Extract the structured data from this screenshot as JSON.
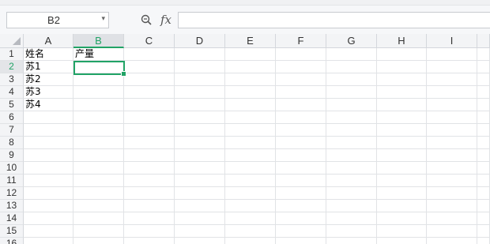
{
  "namebox": {
    "value": "B2"
  },
  "formula_bar": {
    "fx_label": "fx",
    "value": ""
  },
  "columns": [
    {
      "label": "A",
      "width": 63
    },
    {
      "label": "B",
      "width": 64,
      "active": true
    },
    {
      "label": "C",
      "width": 64
    },
    {
      "label": "D",
      "width": 64
    },
    {
      "label": "E",
      "width": 64
    },
    {
      "label": "F",
      "width": 64
    },
    {
      "label": "G",
      "width": 64
    },
    {
      "label": "H",
      "width": 63
    },
    {
      "label": "I",
      "width": 64
    }
  ],
  "rows": [
    {
      "label": "1",
      "cells": [
        "姓名",
        "产量"
      ]
    },
    {
      "label": "2",
      "cells": [
        "苏1",
        ""
      ],
      "active": true
    },
    {
      "label": "3",
      "cells": [
        "苏2",
        ""
      ]
    },
    {
      "label": "4",
      "cells": [
        "苏3",
        ""
      ]
    },
    {
      "label": "5",
      "cells": [
        "苏4",
        ""
      ]
    },
    {
      "label": "6",
      "cells": [
        "",
        ""
      ]
    },
    {
      "label": "7",
      "cells": [
        "",
        ""
      ]
    },
    {
      "label": "8",
      "cells": [
        "",
        ""
      ]
    },
    {
      "label": "9",
      "cells": [
        "",
        ""
      ]
    },
    {
      "label": "10",
      "cells": [
        "",
        ""
      ]
    },
    {
      "label": "11",
      "cells": [
        "",
        ""
      ]
    },
    {
      "label": "12",
      "cells": [
        "",
        ""
      ]
    },
    {
      "label": "13",
      "cells": [
        "",
        ""
      ]
    },
    {
      "label": "14",
      "cells": [
        "",
        ""
      ]
    },
    {
      "label": "15",
      "cells": [
        "",
        ""
      ]
    },
    {
      "label": "16",
      "cells": [
        "",
        ""
      ]
    }
  ],
  "icons": {
    "zoom": "zoom-formula-icon",
    "dropdown": "chevron-down-icon"
  },
  "colors": {
    "accent": "#21a366",
    "header_bg": "#f3f4f6",
    "gridline": "#e1e3e6"
  }
}
